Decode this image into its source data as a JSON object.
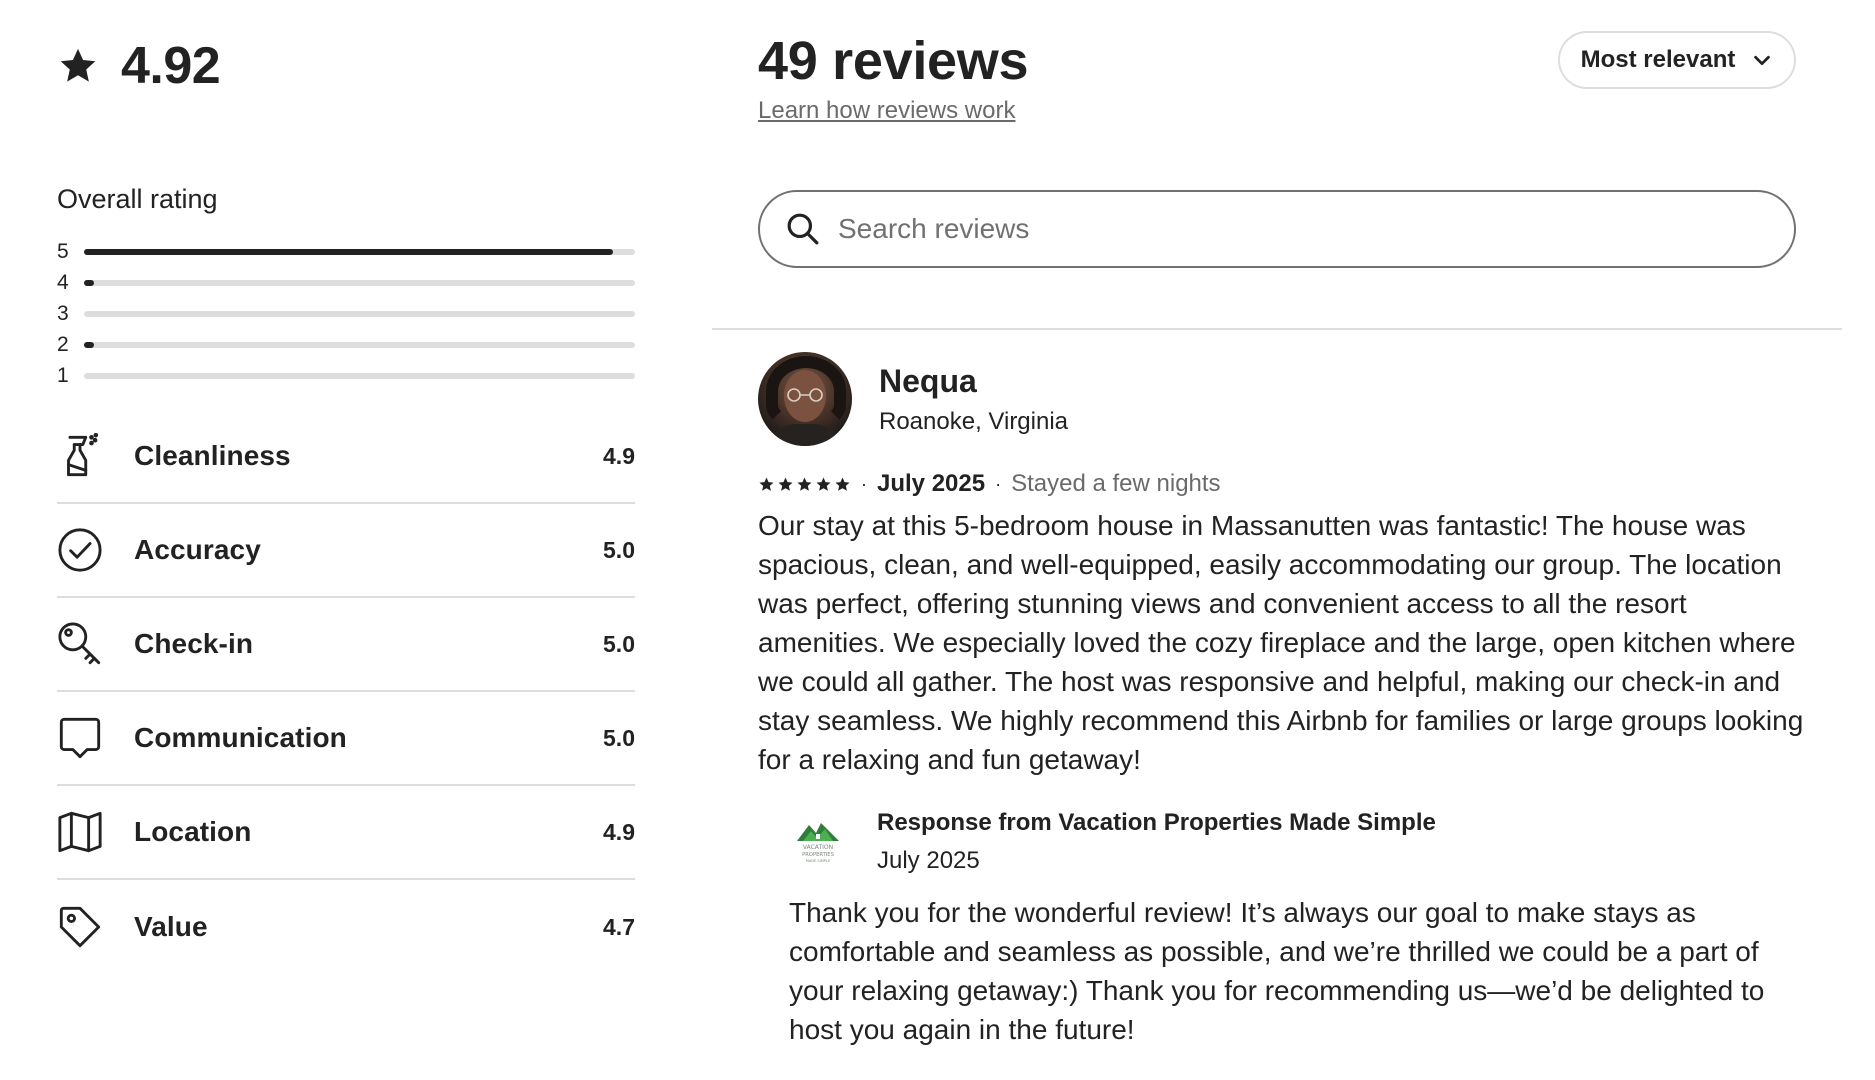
{
  "summary": {
    "overall_score": "4.92",
    "overall_label": "Overall rating",
    "distribution": [
      {
        "stars": "5",
        "fraction": 0.96
      },
      {
        "stars": "4",
        "fraction": 0.02
      },
      {
        "stars": "3",
        "fraction": 0.0
      },
      {
        "stars": "2",
        "fraction": 0.02
      },
      {
        "stars": "1",
        "fraction": 0.0
      }
    ],
    "categories": [
      {
        "name": "Cleanliness",
        "score": "4.9",
        "icon": "spray-bottle-icon"
      },
      {
        "name": "Accuracy",
        "score": "5.0",
        "icon": "check-circle-icon"
      },
      {
        "name": "Check-in",
        "score": "5.0",
        "icon": "key-icon"
      },
      {
        "name": "Communication",
        "score": "5.0",
        "icon": "chat-bubble-icon"
      },
      {
        "name": "Location",
        "score": "4.9",
        "icon": "map-icon"
      },
      {
        "name": "Value",
        "score": "4.7",
        "icon": "tag-icon"
      }
    ]
  },
  "header": {
    "title": "49 reviews",
    "learn_link": "Learn how reviews work",
    "sort_label": "Most relevant"
  },
  "search": {
    "placeholder": "Search reviews",
    "value": ""
  },
  "review": {
    "name": "Nequa",
    "location": "Roanoke, Virginia",
    "rating": 5,
    "date": "July 2025",
    "stay": "Stayed a few nights",
    "text": "Our stay at this 5-bedroom house in Massanutten was fantastic! The house was spacious, clean, and well-equipped, easily accommodating our group. The location was perfect, offering stunning views and convenient access to all the resort amenities. We especially loved the cozy fireplace and the large, open kitchen where we could all gather. The host was responsive and helpful, making our check-in and stay seamless. We highly recommend this Airbnb for families or large groups looking for a relaxing and fun getaway!",
    "response": {
      "from": "Response from Vacation Properties Made Simple",
      "date": "July 2025",
      "text": "Thank you for the wonderful review! It’s always our goal to make stays as comfortable and seamless as possible, and we’re thrilled we could be a part of your relaxing getaway:) Thank you for recommending us—we’d be delighted to host you again in the future!",
      "logo_text": [
        "VACATION",
        "PROPERTIES",
        "MADE SIMPLE"
      ]
    }
  },
  "colors": {
    "text": "#222222",
    "muted": "#6a6a6a",
    "divider": "#dddddd",
    "bar_fill": "#222222",
    "bar_track": "#dddddd",
    "logo_green": "#2e7d3a"
  }
}
